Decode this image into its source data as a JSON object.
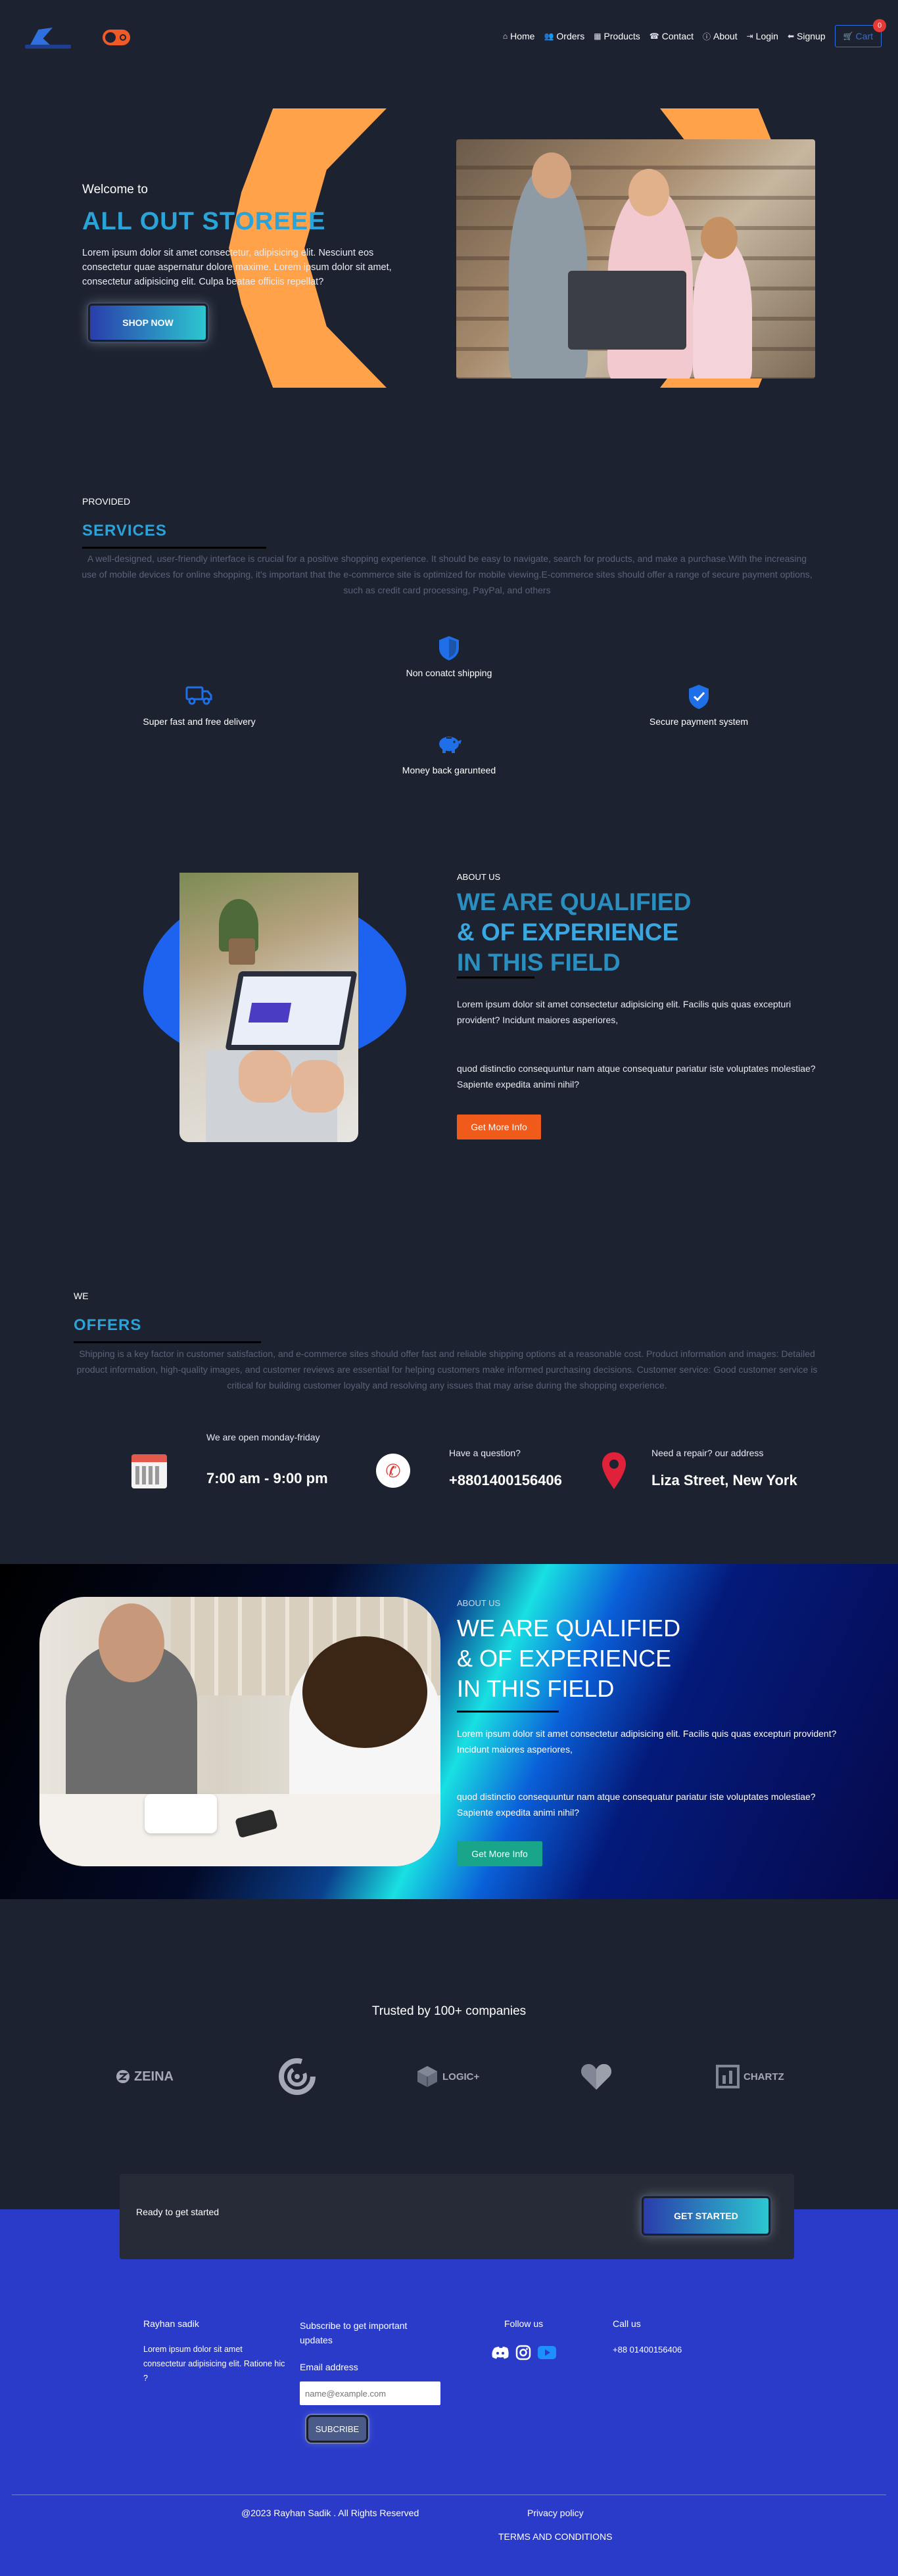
{
  "nav": {
    "items": [
      {
        "label": "Home",
        "icon": "home-icon",
        "glyph": "⌂"
      },
      {
        "label": "Orders",
        "icon": "users-icon",
        "glyph": "👥"
      },
      {
        "label": "Products",
        "icon": "grid-icon",
        "glyph": "▦"
      },
      {
        "label": "Contact",
        "icon": "contact-icon",
        "glyph": "☎"
      },
      {
        "label": "About",
        "icon": "info-icon",
        "glyph": "ⓘ"
      },
      {
        "label": "Login",
        "icon": "login-icon",
        "glyph": "⇥"
      },
      {
        "label": "Signup",
        "icon": "signup-icon",
        "glyph": "⬅"
      }
    ],
    "cart_label": "Cart",
    "cart_count": "0"
  },
  "hero": {
    "welcome": "Welcome to",
    "title": "ALL OUT STOREEE",
    "text": "Lorem ipsum dolor sit amet consectetur, adipisicing elit. Nesciunt eos consectetur quae aspernatur dolore maxime. Lorem ipsum dolor sit amet, consectetur adipisicing elit. Culpa beatae officiis repellat?",
    "button": "SHOP NOW"
  },
  "services": {
    "small": "PROVIDED",
    "title": "SERVICES",
    "paragraph": "A well-designed, user-friendly interface is crucial for a positive shopping experience. It should be easy to navigate, search for products, and make a purchase.With the increasing use of mobile devices for online shopping, it's important that the e-commerce site is optimized for mobile viewing.E-commerce sites should offer a range of secure payment options, such as credit card processing, PayPal, and others",
    "items": [
      {
        "label": "Non conatct shipping",
        "icon": "shield-icon"
      },
      {
        "label": "Super fast and free delivery",
        "icon": "truck-icon"
      },
      {
        "label": "Secure payment system",
        "icon": "verified-shield-icon"
      },
      {
        "label": "Money back garunteed",
        "icon": "piggy-bank-icon"
      }
    ]
  },
  "about": {
    "small": "ABOUT US",
    "title_l1": "WE ARE QUALIFIED",
    "title_l2": "& OF EXPERIENCE",
    "title_l3": "IN THIS FIELD",
    "p1": "Lorem ipsum dolor sit amet consectetur adipisicing elit. Facilis quis quas excepturi provident? Incidunt maiores asperiores,",
    "p2": "quod distinctio consequuntur nam atque consequatur pariatur iste voluptates molestiae? Sapiente expedita animi nihil?",
    "button": "Get More Info"
  },
  "offers": {
    "small": "WE",
    "title": "OFFERS",
    "paragraph": "Shipping is a key factor in customer satisfaction, and e-commerce sites should offer fast and reliable shipping options at a reasonable cost. Product information and images: Detailed product information, high-quality images, and customer reviews are essential for helping customers make informed purchasing decisions. Customer service: Good customer service is critical for building customer loyalty and resolving any issues that may arise during the shopping experience.",
    "hours_label": "We are open monday-friday",
    "hours_value": "7:00 am - 9:00 pm",
    "phone_label": "Have a question?",
    "phone_value": "+8801400156406",
    "address_label": "Need a repair? our address",
    "address_value": "Liza Street, New York"
  },
  "banner": {
    "small": "ABOUT US",
    "title_l1": "WE ARE QUALIFIED",
    "title_l2": "& OF EXPERIENCE",
    "title_l3": "IN THIS FIELD",
    "p1": "Lorem ipsum dolor sit amet consectetur adipisicing elit. Facilis quis quas excepturi provident? Incidunt maiores asperiores,",
    "p2": "quod distinctio consequuntur nam atque consequatur pariatur iste voluptates molestiae? Sapiente expedita animi nihil?",
    "button": "Get More Info"
  },
  "trusted": {
    "title": "Trusted by 100+ companies",
    "brands": [
      "ZEINA",
      "",
      "LOGIC+",
      "",
      "CHARTZ"
    ]
  },
  "cta": {
    "text": "Ready to get started",
    "button": "GET STARTED"
  },
  "footer": {
    "name": "Rayhan sadik",
    "about": "Lorem ipsum dolor sit amet consectetur adipisicing elit. Ratione hic ?",
    "subscribe_title": "Subscribe to get important updates",
    "email_label": "Email address",
    "email_placeholder": "name@example.com",
    "subscribe_button": "SUBCRIBE",
    "follow_title": "Follow us",
    "call_title": "Call us",
    "phone": "+88 01400156406",
    "copyright": "@2023 Rayhan Sadik . All Rights Reserved",
    "privacy": "Privacy policy",
    "terms": "TERMS AND CONDITIONS"
  }
}
